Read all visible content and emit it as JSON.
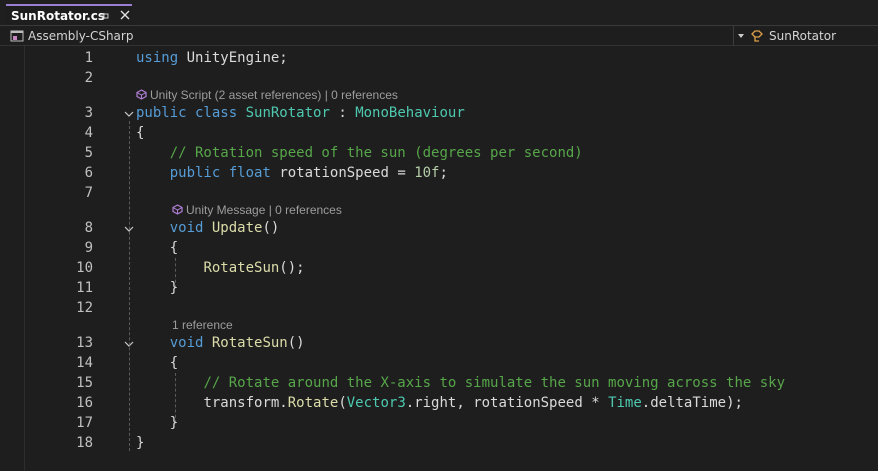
{
  "tab": {
    "title": "SunRotator.cs",
    "pin_icon": "pin-icon",
    "close_icon": "close-icon"
  },
  "navbar": {
    "project": "Assembly-CSharp",
    "class": "SunRotator"
  },
  "lenses": {
    "class": "Unity Script (2 asset references) | 0 references",
    "update": "Unity Message | 0 references",
    "rotate": "1 reference"
  },
  "line_numbers": [
    "1",
    "2",
    "3",
    "4",
    "5",
    "6",
    "7",
    "8",
    "9",
    "10",
    "11",
    "12",
    "13",
    "14",
    "15",
    "16",
    "17",
    "18"
  ],
  "code": {
    "l1": {
      "kw": "using",
      "rest": " UnityEngine;"
    },
    "l3": {
      "kw": "public class",
      "name": "SunRotator",
      "sep": " : ",
      "base": "MonoBehaviour"
    },
    "l4": "{",
    "l5": "// Rotation speed of the sun (degrees per second)",
    "l6": {
      "kw": "public float",
      "name": "rotationSpeed",
      "eq": " = ",
      "num": "10f",
      "end": ";"
    },
    "l8": {
      "kw": "void",
      "fn": "Update",
      "paren": "()"
    },
    "l9": "{",
    "l10": {
      "fn": "RotateSun",
      "rest": "();"
    },
    "l11": "}",
    "l13": {
      "kw": "void",
      "fn": "RotateSun",
      "paren": "()"
    },
    "l14": "{",
    "l15": "// Rotate around the X-axis to simulate the sun moving across the sky",
    "l16": {
      "a": "transform.",
      "fn": "Rotate",
      "b": "(",
      "t1": "Vector3",
      "c": ".right, rotationSpeed * ",
      "t2": "Time",
      "d": ".deltaTime);"
    },
    "l17": "}",
    "l18": "}"
  },
  "colors": {
    "keyword": "#569cd6",
    "type": "#4ec9b0",
    "method": "#dcdcaa",
    "comment": "#57a64a",
    "number": "#b5cea8",
    "tab_accent": "#9a7fd1"
  }
}
